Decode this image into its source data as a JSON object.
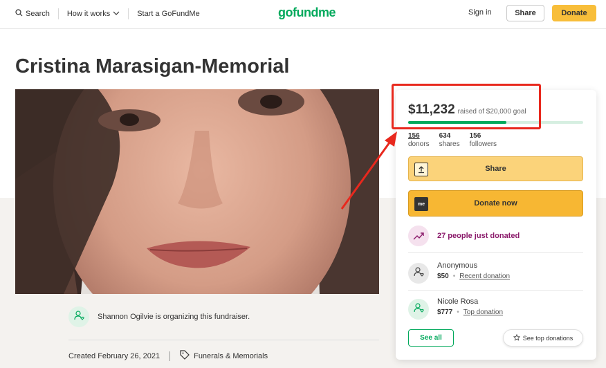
{
  "header": {
    "search_label": "Search",
    "how_it_works_label": "How it works",
    "start_label": "Start a GoFundMe",
    "logo_text": "gofundme",
    "signin_label": "Sign in",
    "share_label": "Share",
    "donate_label": "Donate"
  },
  "campaign": {
    "title": "Cristina Marasigan-Memorial",
    "organizer_text": "Shannon Ogilvie is organizing this fundraiser.",
    "created_text": "Created February 26, 2021",
    "category": "Funerals & Memorials"
  },
  "sidebar": {
    "raised_amount": "$11,232",
    "raised_goal": "raised of $20,000 goal",
    "progress_fraction": 0.56,
    "stats": [
      {
        "value": "156",
        "label": "donors"
      },
      {
        "value": "634",
        "label": "shares"
      },
      {
        "value": "156",
        "label": "followers"
      }
    ],
    "share_label": "Share",
    "donate_label": "Donate now",
    "donate_icon_text": "me",
    "recent_text": "27 people just donated",
    "donors": [
      {
        "name": "Anonymous",
        "amount": "$50",
        "tag": "Recent donation"
      },
      {
        "name": "Nicole Rosa",
        "amount": "$777",
        "tag": "Top donation"
      }
    ],
    "see_all_label": "See all",
    "see_top_label": "See top donations"
  },
  "colors": {
    "brand_green": "#02a95c",
    "donate_yellow": "#f7b733",
    "annotation_red": "#e8281d",
    "recent_purple": "#8b1b6b"
  }
}
